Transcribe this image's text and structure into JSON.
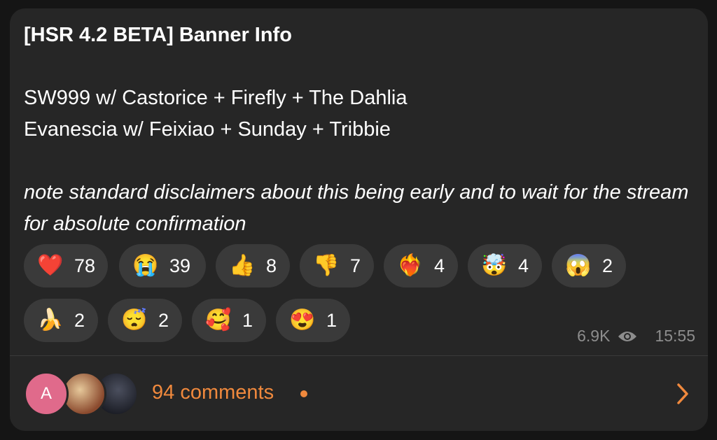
{
  "message": {
    "title": "[HSR 4.2 BETA] Banner Info",
    "line1": "SW999 w/ Castorice + Firefly + The Dahlia",
    "line2": "Evanescia w/ Feixiao + Sunday + Tribbie",
    "note": "note standard disclaimers about this being early and to wait for the stream for absolute confirmation"
  },
  "reactions": [
    {
      "emoji": "❤️",
      "count": "78"
    },
    {
      "emoji": "😭",
      "count": "39"
    },
    {
      "emoji": "👍",
      "count": "8"
    },
    {
      "emoji": "👎",
      "count": "7"
    },
    {
      "emoji": "❤️‍🔥",
      "count": "4"
    },
    {
      "emoji": "🤯",
      "count": "4"
    },
    {
      "emoji": "😱",
      "count": "2"
    },
    {
      "emoji": "🍌",
      "count": "2"
    },
    {
      "emoji": "😴",
      "count": "2"
    },
    {
      "emoji": "🥰",
      "count": "1"
    },
    {
      "emoji": "😍",
      "count": "1"
    }
  ],
  "meta": {
    "views": "6.9K",
    "time": "15:55",
    "views_icon": "eye-icon"
  },
  "comments": {
    "avatar_letter": "A",
    "label": "94 comments",
    "accent_color": "#f0893d",
    "chevron_icon": "chevron-right-icon"
  }
}
